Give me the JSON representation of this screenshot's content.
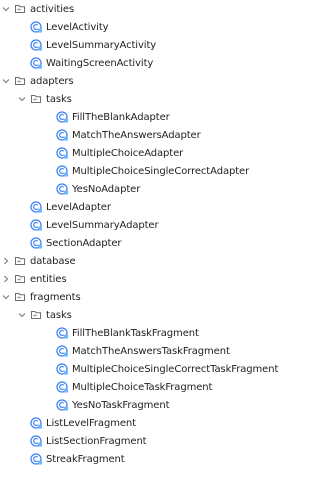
{
  "colors": {
    "text": "#1f1f1f",
    "chevron": "#7a7a7a",
    "folder_stroke": "#6e6e6e",
    "class_icon_blue": "#3d82f6",
    "class_icon_badge": "#6fb4ff"
  },
  "project_tree": {
    "items": [
      {
        "label": "activities",
        "type": "folder",
        "expanded": true,
        "depth": 0
      },
      {
        "label": "LevelActivity",
        "type": "class",
        "depth": 1
      },
      {
        "label": "LevelSummaryActivity",
        "type": "class",
        "depth": 1
      },
      {
        "label": "WaitingScreenActivity",
        "type": "class",
        "depth": 1
      },
      {
        "label": "adapters",
        "type": "folder",
        "expanded": true,
        "depth": 0
      },
      {
        "label": "tasks",
        "type": "folder",
        "expanded": true,
        "depth": 1
      },
      {
        "label": "FillTheBlankAdapter",
        "type": "class",
        "depth": 2
      },
      {
        "label": "MatchTheAnswersAdapter",
        "type": "class",
        "depth": 2
      },
      {
        "label": "MultipleChoiceAdapter",
        "type": "class",
        "depth": 2
      },
      {
        "label": "MultipleChoiceSingleCorrectAdapter",
        "type": "class",
        "depth": 2
      },
      {
        "label": "YesNoAdapter",
        "type": "class",
        "depth": 2
      },
      {
        "label": "LevelAdapter",
        "type": "class",
        "depth": 1
      },
      {
        "label": "LevelSummaryAdapter",
        "type": "class",
        "depth": 1
      },
      {
        "label": "SectionAdapter",
        "type": "class",
        "depth": 1
      },
      {
        "label": "database",
        "type": "folder",
        "expanded": false,
        "depth": 0
      },
      {
        "label": "entities",
        "type": "folder",
        "expanded": false,
        "depth": 0
      },
      {
        "label": "fragments",
        "type": "folder",
        "expanded": true,
        "depth": 0
      },
      {
        "label": "tasks",
        "type": "folder",
        "expanded": true,
        "depth": 1
      },
      {
        "label": "FillTheBlankTaskFragment",
        "type": "class",
        "depth": 2
      },
      {
        "label": "MatchTheAnswersTaskFragment",
        "type": "class",
        "depth": 2
      },
      {
        "label": "MultipleChoiceSingleCorrectTaskFragment",
        "type": "class",
        "depth": 2
      },
      {
        "label": "MultipleChoiceTaskFragment",
        "type": "class",
        "depth": 2
      },
      {
        "label": "YesNoTaskFragment",
        "type": "class",
        "depth": 2
      },
      {
        "label": "ListLevelFragment",
        "type": "class",
        "depth": 1
      },
      {
        "label": "ListSectionFragment",
        "type": "class",
        "depth": 1
      },
      {
        "label": "StreakFragment",
        "type": "class",
        "depth": 1
      }
    ]
  }
}
